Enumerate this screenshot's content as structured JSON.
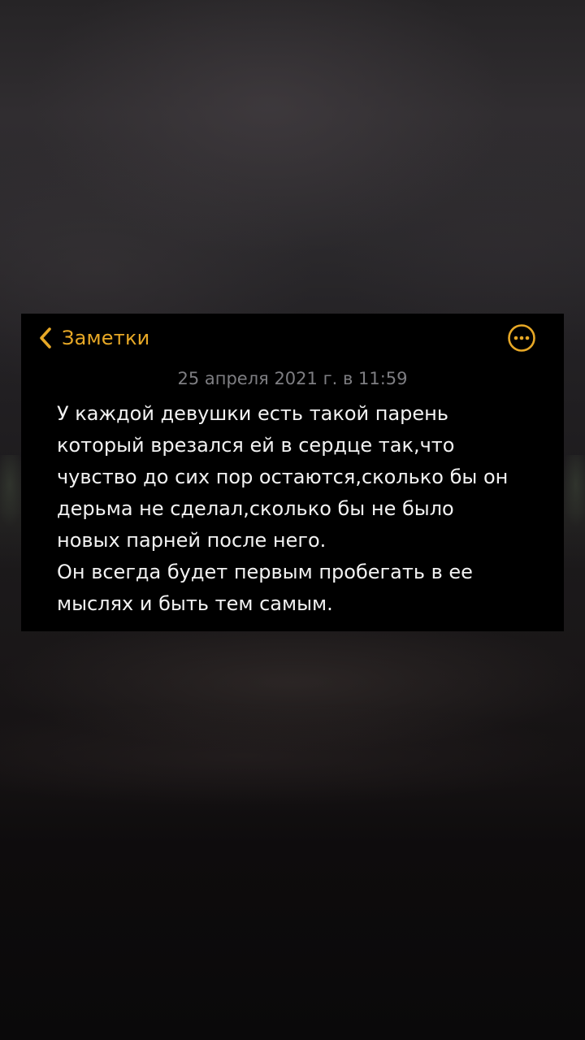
{
  "app": {
    "back_label": "Заметки",
    "accent_color": "#e7a826",
    "back_icon": "chevron-left-icon",
    "more_icon": "ellipsis-circle-icon"
  },
  "note": {
    "timestamp": "25 апреля 2021 г. в 11:59",
    "lines": [
      "У каждой девушки есть такой парень",
      "который врезался ей в сердце так,что",
      "чувство до сих пор остаются,сколько бы он",
      "дерьма не сделал,сколько бы не было",
      "новых парней после него.",
      "Он всегда будет первым пробегать в ее",
      "мыслях и быть тем самым."
    ]
  }
}
